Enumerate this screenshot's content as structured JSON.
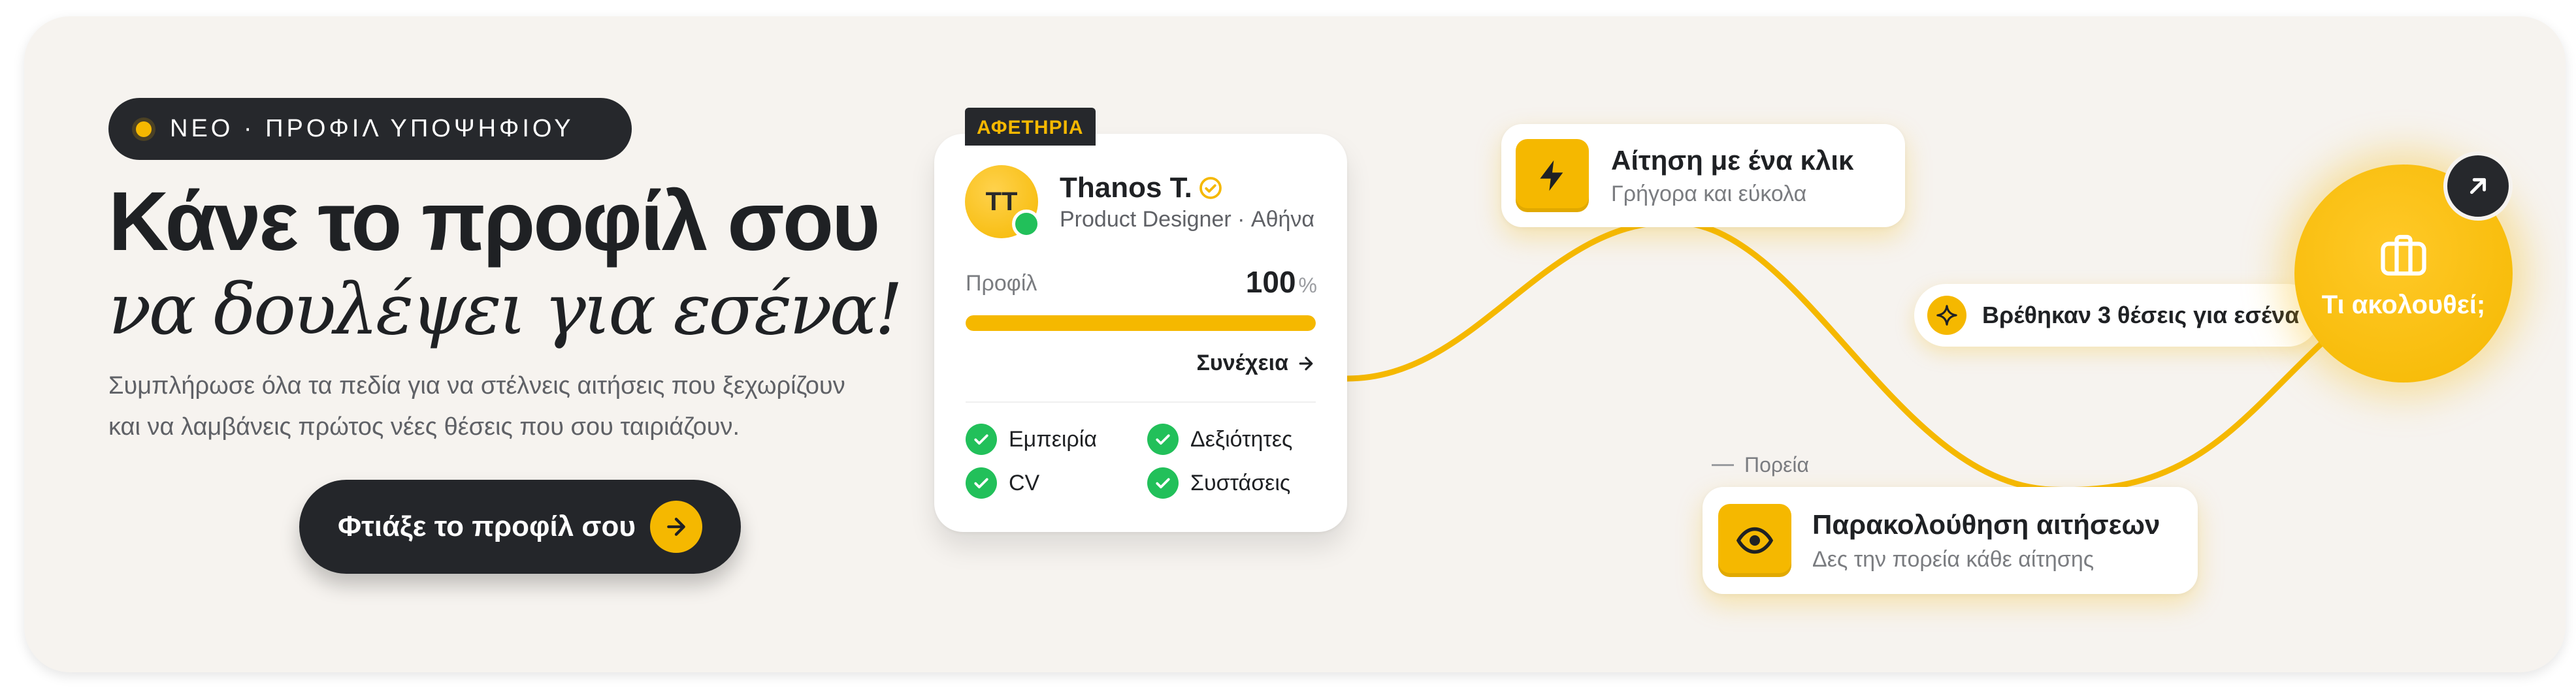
{
  "colors": {
    "accent": "#f5b800",
    "dark": "#26282c",
    "success": "#22c05a",
    "background": "#f6f3ef"
  },
  "badge": {
    "text": "ΝΕΟ · ΠΡΟΦΙΛ ΥΠΟΨΗΦΙΟΥ"
  },
  "hero": {
    "headline": "Κάνε το προφίλ σου",
    "headline_italic": "να δουλέψει για εσένα!",
    "subtitle_line1": "Συμπλήρωσε όλα τα πεδία για να στέλνεις αιτήσεις που ξεχωρίζουν",
    "subtitle_line2": "και να λαμβάνεις πρώτος νέες θέσεις που σου ταιριάζουν."
  },
  "cta": {
    "label": "Φτιάξε το προφίλ σου",
    "icon": "arrow-right-icon"
  },
  "profile_card": {
    "tag": "ΑΦΕΤΗΡΙΑ",
    "initials": "TT",
    "name": "Thanos T.",
    "role": "Product Designer · Αθήνα",
    "progress_label": "Προφίλ",
    "progress_value": "100",
    "progress_unit": "%",
    "progress_fraction": 1.0,
    "continue_label": "Συνέχεια",
    "checklist": [
      "Εμπειρία",
      "Δεξιότητες",
      "CV",
      "Συστάσεις"
    ]
  },
  "features": {
    "apply": {
      "title": "Αίτηση με ένα κλικ",
      "subtitle": "Γρήγορα και εύκολα",
      "icon": "lightning-icon"
    },
    "track": {
      "title": "Παρακολούθηση αιτήσεων",
      "subtitle": "Δες την πορεία κάθε αίτησης",
      "icon": "eye-icon"
    }
  },
  "found": {
    "text": "Βρέθηκαν 3 θέσεις για εσένα",
    "icon": "sparkle-icon"
  },
  "route_label": "Πορεία",
  "next": {
    "label": "Τι ακολουθεί;",
    "icon": "briefcase-icon",
    "corner_icon": "arrow-up-right-icon"
  }
}
